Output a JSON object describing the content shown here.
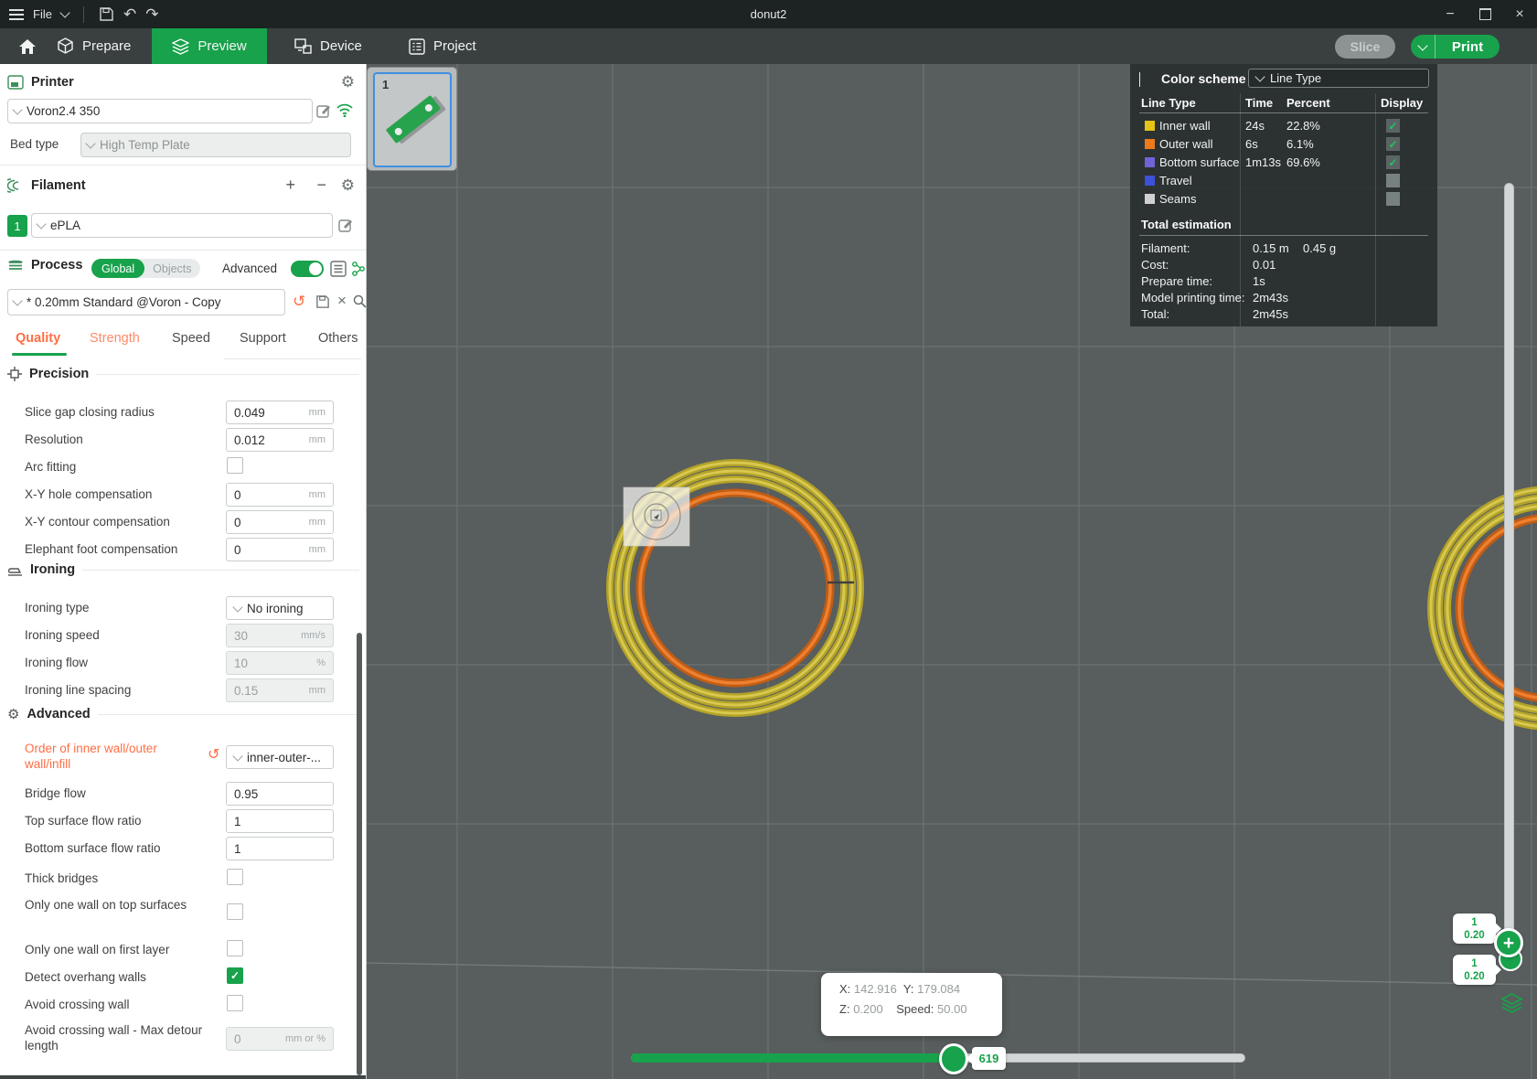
{
  "titlebar": {
    "file_menu": "File",
    "title": "donut2"
  },
  "nav": {
    "tabs": [
      {
        "label": "Prepare"
      },
      {
        "label": "Preview"
      },
      {
        "label": "Device"
      },
      {
        "label": "Project"
      }
    ]
  },
  "actions": {
    "slice": "Slice",
    "print": "Print"
  },
  "printer": {
    "title": "Printer",
    "name": "Voron2.4 350",
    "bed_type_label": "Bed type",
    "bed_type": "High Temp Plate"
  },
  "filament": {
    "title": "Filament",
    "slot": "1",
    "name": "ePLA",
    "plus": "+",
    "minus": "−"
  },
  "process": {
    "title": "Process",
    "global": "Global",
    "objects": "Objects",
    "advanced_label": "Advanced",
    "preset": "* 0.20mm Standard @Voron - Copy",
    "tabs": [
      "Quality",
      "Strength",
      "Speed",
      "Support",
      "Others"
    ]
  },
  "settings": {
    "precision": {
      "title": "Precision",
      "rows": [
        {
          "label": "Slice gap closing radius",
          "value": "0.049",
          "unit": "mm"
        },
        {
          "label": "Resolution",
          "value": "0.012",
          "unit": "mm"
        },
        {
          "label": "Arc fitting",
          "checked": false
        },
        {
          "label": "X-Y hole compensation",
          "value": "0",
          "unit": "mm"
        },
        {
          "label": "X-Y contour compensation",
          "value": "0",
          "unit": "mm"
        },
        {
          "label": "Elephant foot compensation",
          "value": "0",
          "unit": "mm"
        }
      ]
    },
    "ironing": {
      "title": "Ironing",
      "rows": [
        {
          "label": "Ironing type",
          "value": "No ironing",
          "type": "select"
        },
        {
          "label": "Ironing speed",
          "value": "30",
          "unit": "mm/s",
          "disabled": true
        },
        {
          "label": "Ironing flow",
          "value": "10",
          "unit": "%",
          "disabled": true
        },
        {
          "label": "Ironing line spacing",
          "value": "0.15",
          "unit": "mm",
          "disabled": true
        }
      ]
    },
    "advanced": {
      "title": "Advanced",
      "rows": [
        {
          "label": "Order of inner wall/outer wall/infill",
          "value": "inner-outer-...",
          "type": "select",
          "modified": true
        },
        {
          "label": "Bridge flow",
          "value": "0.95"
        },
        {
          "label": "Top surface flow ratio",
          "value": "1"
        },
        {
          "label": "Bottom surface flow ratio",
          "value": "1"
        },
        {
          "label": "Thick bridges",
          "checked": false
        },
        {
          "label": "Only one wall on top surfaces",
          "checked": false
        },
        {
          "label": "Only one wall on first layer",
          "checked": false
        },
        {
          "label": "Detect overhang walls",
          "checked": true
        },
        {
          "label": "Avoid crossing wall",
          "checked": false
        },
        {
          "label": "Avoid crossing wall - Max detour length",
          "value": "0",
          "unit": "mm or %",
          "disabled": true
        }
      ]
    }
  },
  "plate_thumb": {
    "number": "1"
  },
  "color_scheme": {
    "title": "Color scheme",
    "mode": "Line Type",
    "columns": [
      "Line Type",
      "Time",
      "Percent",
      "Display"
    ],
    "rows": [
      {
        "label": "Inner wall",
        "time": "24s",
        "percent": "22.8%",
        "color": "#e5c417",
        "display": true
      },
      {
        "label": "Outer wall",
        "time": "6s",
        "percent": "6.1%",
        "color": "#ee7a1c",
        "display": true
      },
      {
        "label": "Bottom surface",
        "time": "1m13s",
        "percent": "69.6%",
        "color": "#6f63d6",
        "display": true
      },
      {
        "label": "Travel",
        "time": "",
        "percent": "",
        "color": "#3c52d9",
        "display": false
      },
      {
        "label": "Seams",
        "time": "",
        "percent": "",
        "color": "#d0d0d0",
        "display": false
      }
    ],
    "estimation": {
      "title": "Total estimation",
      "rows": [
        {
          "label": "Filament:",
          "value": "0.15 m",
          "value2": "0.45 g"
        },
        {
          "label": "Cost:",
          "value": "0.01"
        },
        {
          "label": "Prepare time:",
          "value": "1s"
        },
        {
          "label": "Model printing time:",
          "value": "2m43s"
        },
        {
          "label": "Total:",
          "value": "2m45s"
        }
      ]
    }
  },
  "status_tooltip": {
    "x_label": "X:",
    "x": "142.916",
    "y_label": "Y:",
    "y": "179.084",
    "z_label": "Z:",
    "z": "0.200",
    "speed_label": "Speed:",
    "speed": "50.00"
  },
  "move_slider": {
    "value": "619"
  },
  "layer_slider": {
    "upper_layer": "1",
    "upper_height": "0.20",
    "lower_layer": "1",
    "lower_height": "0.20"
  },
  "colors": {
    "accent_green": "#17a24b",
    "modified_orange": "#ff6e45",
    "wall_yellow": "#c9b834",
    "wall_orange": "#c96217"
  }
}
